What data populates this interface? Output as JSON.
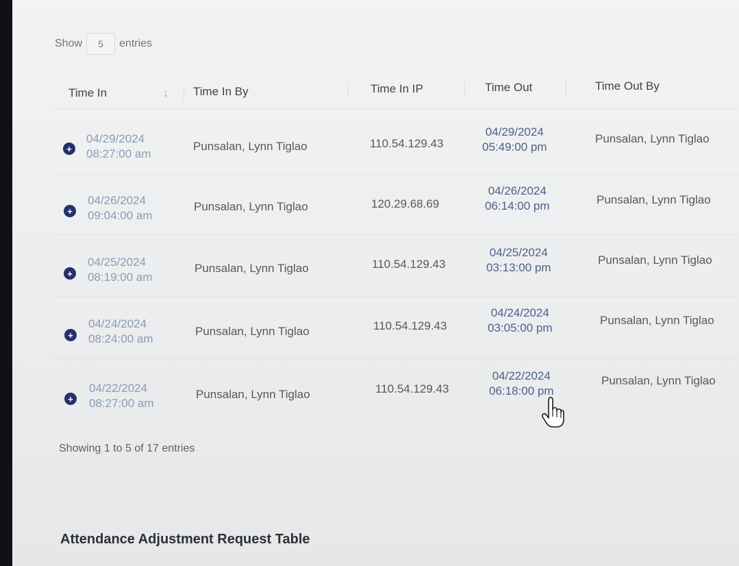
{
  "length": {
    "show_label": "Show",
    "value": "5",
    "entries_label": "entries"
  },
  "columns": [
    "Time In",
    "Time In By",
    "Time In IP",
    "Time Out",
    "Time Out By"
  ],
  "rows": [
    {
      "time_in_date": "04/29/2024",
      "time_in_time": "08:27:00 am",
      "time_in_by": "Punsalan, Lynn Tiglao",
      "ip": "110.54.129.43",
      "time_out_date": "04/29/2024",
      "time_out_time": "05:49:00 pm",
      "time_out_by": "Punsalan, Lynn Tiglao"
    },
    {
      "time_in_date": "04/26/2024",
      "time_in_time": "09:04:00 am",
      "time_in_by": "Punsalan, Lynn Tiglao",
      "ip": "120.29.68.69",
      "time_out_date": "04/26/2024",
      "time_out_time": "06:14:00 pm",
      "time_out_by": "Punsalan, Lynn Tiglao"
    },
    {
      "time_in_date": "04/25/2024",
      "time_in_time": "08:19:00 am",
      "time_in_by": "Punsalan, Lynn Tiglao",
      "ip": "110.54.129.43",
      "time_out_date": "04/25/2024",
      "time_out_time": "03:13:00 pm",
      "time_out_by": "Punsalan, Lynn Tiglao"
    },
    {
      "time_in_date": "04/24/2024",
      "time_in_time": "08:24:00 am",
      "time_in_by": "Punsalan, Lynn Tiglao",
      "ip": "110.54.129.43",
      "time_out_date": "04/24/2024",
      "time_out_time": "03:05:00 pm",
      "time_out_by": "Punsalan, Lynn Tiglao"
    },
    {
      "time_in_date": "04/22/2024",
      "time_in_time": "08:27:00 am",
      "time_in_by": "Punsalan, Lynn Tiglao",
      "ip": "110.54.129.43",
      "time_out_date": "04/22/2024",
      "time_out_time": "06:18:00 pm",
      "time_out_by": "Punsalan, Lynn Tiglao"
    }
  ],
  "info": "Showing 1 to 5 of 17 entries",
  "section_title": "Attendance Adjustment Request Table",
  "icons": {
    "sort": "sort-desc-icon",
    "expand": "plus-circle-icon",
    "cursor": "hand-pointer-icon"
  },
  "colors": {
    "link": "#4c5f8a",
    "muted_link": "#8a9bb8",
    "expand": "#25316a"
  }
}
